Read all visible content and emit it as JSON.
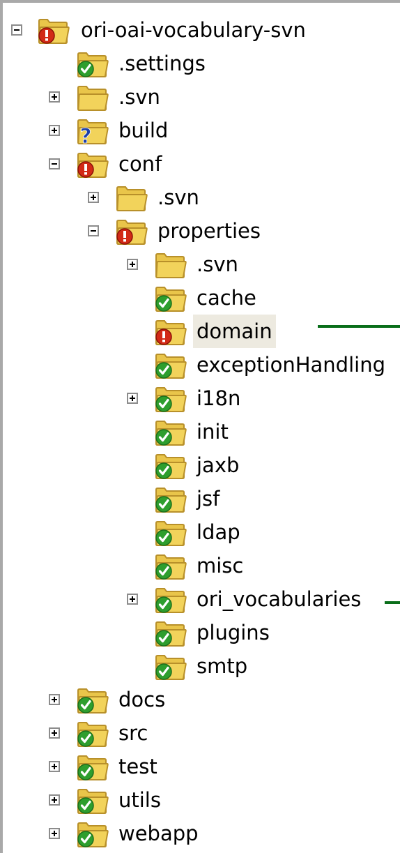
{
  "tree": {
    "nodes": [
      {
        "label": "ori-oai-vocabulary-svn",
        "status": "conflict",
        "expander": "minus"
      },
      {
        "label": ".settings",
        "status": "normal",
        "expander": "none"
      },
      {
        "label": ".svn",
        "status": "plain",
        "expander": "plus"
      },
      {
        "label": "build",
        "status": "unversioned",
        "expander": "plus"
      },
      {
        "label": "conf",
        "status": "conflict",
        "expander": "minus"
      },
      {
        "label": ".svn",
        "status": "plain",
        "expander": "plus"
      },
      {
        "label": "properties",
        "status": "conflict",
        "expander": "minus"
      },
      {
        "label": ".svn",
        "status": "plain",
        "expander": "plus"
      },
      {
        "label": "cache",
        "status": "normal",
        "expander": "none"
      },
      {
        "label": "domain",
        "status": "conflict",
        "expander": "none",
        "selected": true
      },
      {
        "label": "exceptionHandling",
        "status": "normal",
        "expander": "none"
      },
      {
        "label": "i18n",
        "status": "normal",
        "expander": "plus"
      },
      {
        "label": "init",
        "status": "normal",
        "expander": "none"
      },
      {
        "label": "jaxb",
        "status": "normal",
        "expander": "none"
      },
      {
        "label": "jsf",
        "status": "normal",
        "expander": "none"
      },
      {
        "label": "ldap",
        "status": "normal",
        "expander": "none"
      },
      {
        "label": "misc",
        "status": "normal",
        "expander": "none"
      },
      {
        "label": "ori_vocabularies",
        "status": "normal",
        "expander": "plus"
      },
      {
        "label": "plugins",
        "status": "normal",
        "expander": "none"
      },
      {
        "label": "smtp",
        "status": "normal",
        "expander": "none"
      },
      {
        "label": "docs",
        "status": "normal",
        "expander": "plus"
      },
      {
        "label": "src",
        "status": "normal",
        "expander": "plus"
      },
      {
        "label": "test",
        "status": "normal",
        "expander": "plus"
      },
      {
        "label": "utils",
        "status": "normal",
        "expander": "plus"
      },
      {
        "label": "webapp",
        "status": "normal",
        "expander": "plus"
      }
    ]
  },
  "colors": {
    "folder_fill": "#f2d35b",
    "folder_tab": "#e9c54a",
    "folder_outline": "#b8902a",
    "badge_normal": "#2e9e2e",
    "badge_conflict": "#d22a16",
    "badge_unversioned": "#1d3fa8",
    "selection": "#edeae0",
    "annotation_line": "#0a6e1a"
  }
}
